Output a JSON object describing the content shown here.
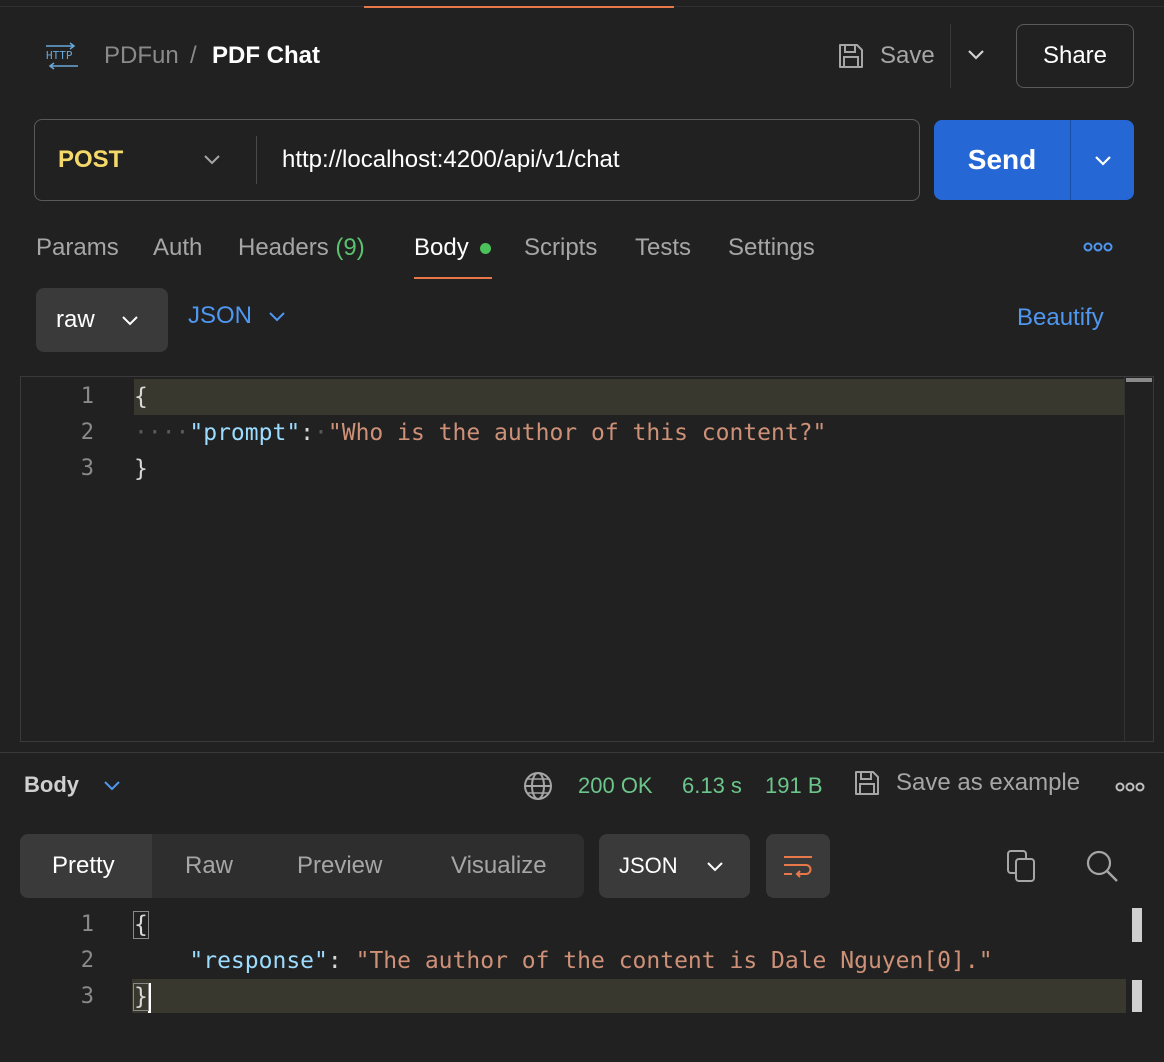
{
  "header": {
    "icon": "http-icon",
    "breadcrumb_parent": "PDFun",
    "breadcrumb_separator": "/",
    "breadcrumb_current": "PDF Chat",
    "save_label": "Save",
    "share_label": "Share"
  },
  "request": {
    "method": "POST",
    "url": "http://localhost:4200/api/v1/chat",
    "send_label": "Send"
  },
  "request_tabs": {
    "params": "Params",
    "auth": "Auth",
    "headers": "Headers",
    "headers_count": "(9)",
    "body": "Body",
    "scripts": "Scripts",
    "tests": "Tests",
    "settings": "Settings",
    "active": "Body"
  },
  "body_options": {
    "mode": "raw",
    "language": "JSON",
    "beautify_label": "Beautify"
  },
  "request_body": {
    "line_numbers": [
      "1",
      "2",
      "3"
    ],
    "open_brace": "{",
    "indent": "····",
    "key": "\"prompt\"",
    "colon": ":",
    "value": "\"Who is the author of this content?\"",
    "close_brace": "}"
  },
  "response": {
    "section_label": "Body",
    "status": "200 OK",
    "time": "6.13 s",
    "size": "191 B",
    "save_example_label": "Save as example",
    "view_tabs": {
      "pretty": "Pretty",
      "raw": "Raw",
      "preview": "Preview",
      "visualize": "Visualize",
      "active": "Pretty"
    },
    "format": "JSON",
    "line_numbers": [
      "1",
      "2",
      "3"
    ],
    "open_brace": "{",
    "key": "\"response\"",
    "colon": ":",
    "value": "\"The author of the content is Dale Nguyen[0].\"",
    "close_brace": "}"
  },
  "colors": {
    "accent_orange": "#e8774a",
    "send_blue": "#2667d6",
    "link_blue": "#4f97f0",
    "method_yellow": "#f4d96a",
    "status_green": "#6cc58a"
  }
}
